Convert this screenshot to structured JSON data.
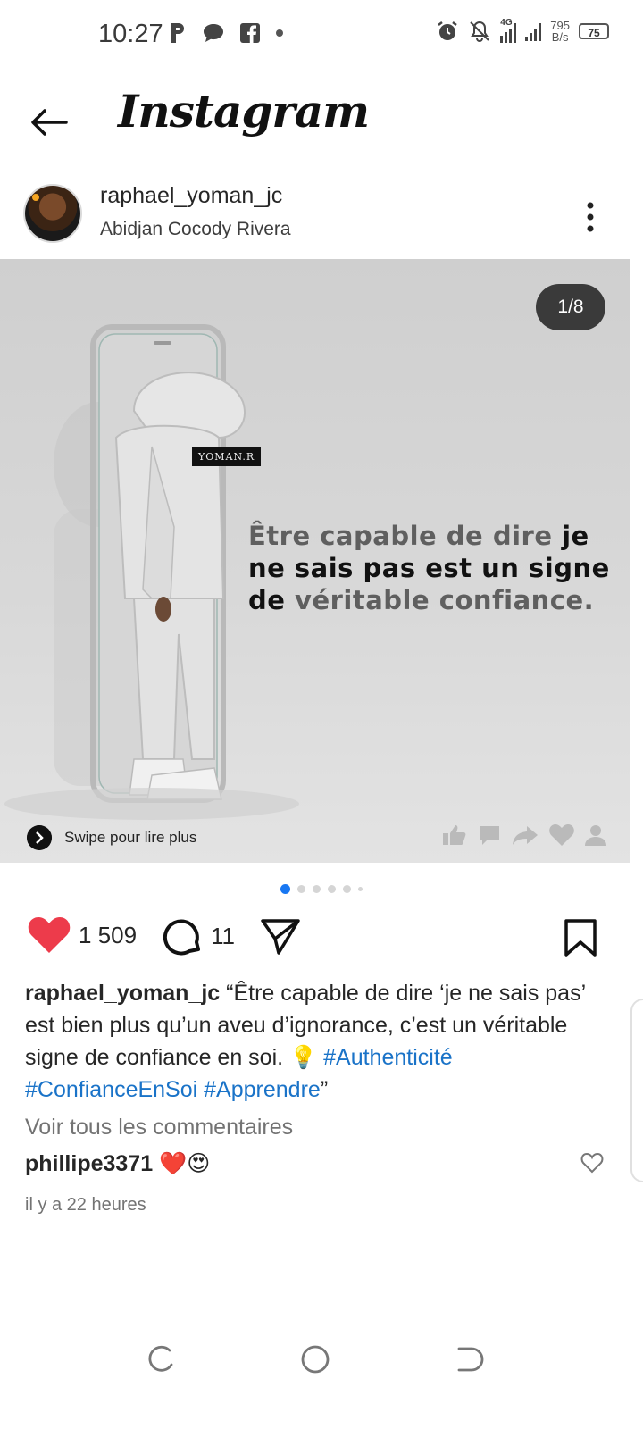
{
  "status_bar": {
    "time": "10:27",
    "net_speed_value": "795",
    "net_speed_unit": "B/s",
    "battery": "75",
    "signal_label": "4G"
  },
  "header": {
    "title": "Instagram"
  },
  "post": {
    "username": "raphael_yoman_jc",
    "location": "Abidjan Cocody Rivera",
    "page_counter": "1/8",
    "brand_tag": "YOMAN.R",
    "quote_part1": "Être capable de dire",
    "quote_part2": "je ne sais pas est un signe de",
    "quote_part3": "véritable confiance.",
    "swipe_text": "Swipe pour lire plus",
    "carousel_active_index": 0,
    "carousel_visible_dots": 6
  },
  "actions": {
    "likes": "1 509",
    "comments": "11"
  },
  "caption": {
    "username": "raphael_yoman_jc",
    "text": "“Être capable de dire ‘je ne sais pas’ est bien plus qu’un aveu d’ignorance, c’est un véritable signe de confiance en soi. 💡",
    "hashtag1": "#Authenticité",
    "hashtag2": "#ConfianceEnSoi",
    "hashtag3": "#Apprendre",
    "closing": "”"
  },
  "comments": {
    "view_all": "Voir tous les commentaires",
    "first_user": "phillipe3371",
    "first_text": "❤️😍"
  },
  "timestamp": "il y a 22 heures",
  "colors": {
    "accent": "#1877f2",
    "hashtag": "#1a73c8",
    "like": "#ed3b4b"
  }
}
